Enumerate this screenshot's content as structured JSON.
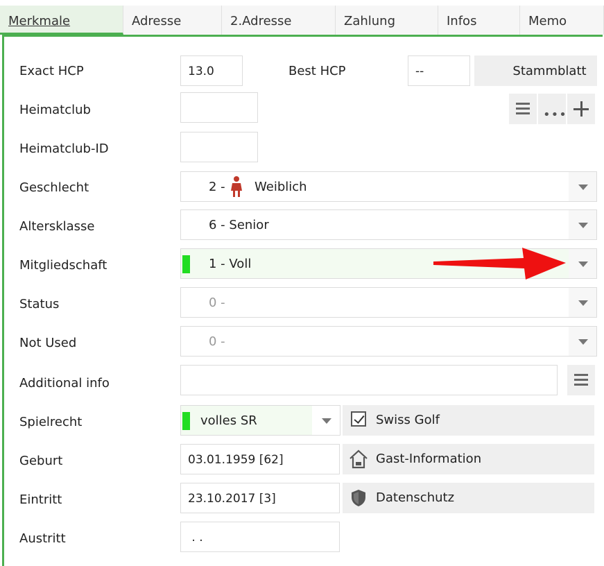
{
  "tabs": [
    {
      "label": "Merkmale",
      "active": true
    },
    {
      "label": "Adresse"
    },
    {
      "label": "2.Adresse"
    },
    {
      "label": "Zahlung"
    },
    {
      "label": "Infos"
    },
    {
      "label": "Memo"
    }
  ],
  "form": {
    "exact_hcp_label": "Exact HCP",
    "exact_hcp_value": "13.0",
    "best_hcp_label": "Best HCP",
    "best_hcp_value": "--",
    "stammblatt_label": "Stammblatt",
    "heimatclub_label": "Heimatclub",
    "heimatclub_value": "",
    "heimatclub_id_label": "Heimatclub-ID",
    "heimatclub_id_value": "",
    "geschlecht_label": "Geschlecht",
    "geschlecht_code": "2 -",
    "geschlecht_text": "Weiblich",
    "altersklasse_label": "Altersklasse",
    "altersklasse_value": "6 - Senior",
    "mitgliedschaft_label": "Mitgliedschaft",
    "mitgliedschaft_value": "1 - Voll",
    "status_label": "Status",
    "status_value": "0 -",
    "not_used_label": "Not Used",
    "not_used_value": "0 -",
    "additional_info_label": "Additional info",
    "additional_info_value": "",
    "spielrecht_label": "Spielrecht",
    "spielrecht_value": "volles SR",
    "swiss_golf_label": "Swiss Golf",
    "swiss_golf_checked": true,
    "geburt_label": "Geburt",
    "geburt_value": "03.01.1959  [62]",
    "gast_info_label": "Gast-Information",
    "eintritt_label": "Eintritt",
    "eintritt_value": "23.10.2017  [3]",
    "datenschutz_label": "Datenschutz",
    "austritt_label": "Austritt",
    "austritt_value": " . ."
  },
  "colors": {
    "accent_green": "#4caf50",
    "status_green": "#22dd22",
    "arrow_red": "#ee1111",
    "female_icon": "#c0392b"
  },
  "icons": [
    "female-person-icon",
    "hamburger-icon",
    "more-dots-icon",
    "plus-icon",
    "checkbox-icon",
    "house-icon",
    "shield-icon",
    "dropdown-arrow-icon",
    "red-arrow-annotation"
  ]
}
